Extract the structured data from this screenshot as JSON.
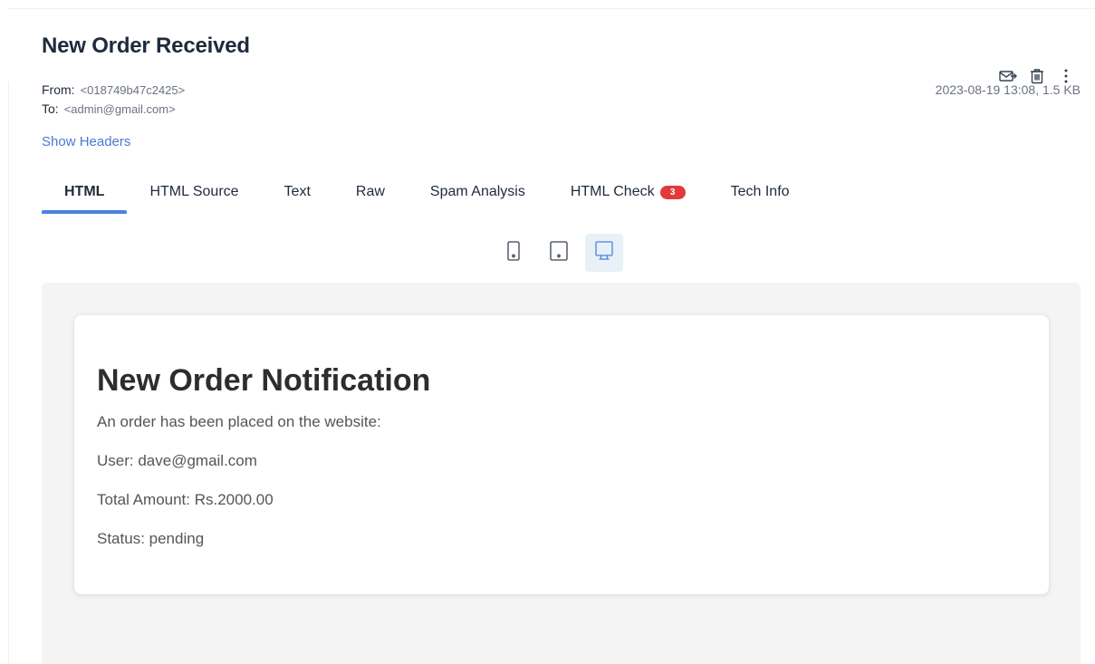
{
  "message": {
    "subject": "New Order Received",
    "from_label": "From:",
    "from_value": "<018749b47c2425>",
    "to_label": "To:",
    "to_value": "<admin@gmail.com>",
    "timestamp": "2023-08-19 13:08, 1.5 KB",
    "show_headers": "Show Headers"
  },
  "actions": [
    {
      "name": "forward-icon"
    },
    {
      "name": "trash-icon"
    },
    {
      "name": "more-vertical-icon"
    }
  ],
  "tabs": [
    {
      "label": "HTML",
      "active": true
    },
    {
      "label": "HTML Source"
    },
    {
      "label": "Text"
    },
    {
      "label": "Raw"
    },
    {
      "label": "Spam Analysis"
    },
    {
      "label": "HTML Check",
      "badge": "3"
    },
    {
      "label": "Tech Info"
    }
  ],
  "devices": [
    {
      "name": "mobile-icon",
      "active": false
    },
    {
      "name": "tablet-icon",
      "active": false
    },
    {
      "name": "desktop-icon",
      "active": true
    }
  ],
  "colors": {
    "accent": "#4a82e0",
    "badge": "#e03a3a",
    "link": "#4a78d4"
  },
  "email": {
    "heading": "New Order Notification",
    "intro": "An order has been placed on the website:",
    "user": "User: dave@gmail.com",
    "total": "Total Amount: Rs.2000.00",
    "status": "Status: pending"
  }
}
